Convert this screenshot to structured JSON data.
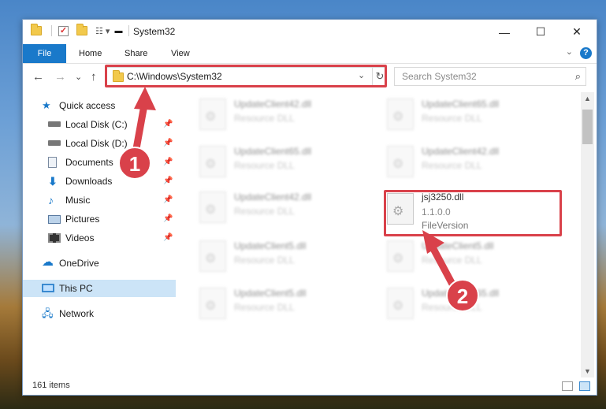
{
  "window": {
    "title": "System32",
    "controls": {
      "minimize": "—",
      "maximize": "☐",
      "close": "✕"
    }
  },
  "ribbon": {
    "file": "File",
    "tabs": [
      "Home",
      "Share",
      "View"
    ],
    "collapse": "⌄",
    "help": "?"
  },
  "nav": {
    "back": "←",
    "forward": "→",
    "recent": "⌄",
    "up": "↑",
    "address": "C:\\Windows\\System32",
    "address_dropdown": "⌄",
    "refresh": "↻",
    "search_placeholder": "Search System32",
    "search_icon": "⌕"
  },
  "sidebar": {
    "items": [
      {
        "label": "Quick access",
        "icon": "star-icon",
        "pinned": false
      },
      {
        "label": "Local Disk (C:)",
        "icon": "drive-icon",
        "pinned": true
      },
      {
        "label": "Local Disk (D:)",
        "icon": "drive-icon",
        "pinned": true
      },
      {
        "label": "Documents",
        "icon": "documents-icon",
        "pinned": true
      },
      {
        "label": "Downloads",
        "icon": "download-icon",
        "pinned": true
      },
      {
        "label": "Music",
        "icon": "music-icon",
        "pinned": true
      },
      {
        "label": "Pictures",
        "icon": "pictures-icon",
        "pinned": true
      },
      {
        "label": "Videos",
        "icon": "videos-icon",
        "pinned": true
      },
      {
        "label": "OneDrive",
        "icon": "cloud-icon",
        "pinned": false
      },
      {
        "label": "This PC",
        "icon": "computer-icon",
        "pinned": false
      },
      {
        "label": "Network",
        "icon": "network-icon",
        "pinned": false
      }
    ],
    "pin_glyph": "📌"
  },
  "files": [
    {
      "name": "UpdateClient42.dll",
      "type": "Resource DLL"
    },
    {
      "name": "UpdateClient65.dll",
      "type": "Resource DLL"
    },
    {
      "name": "UpdateClient65.dll",
      "type": "Resource DLL"
    },
    {
      "name": "UpdateClient42.dll",
      "type": "Resource DLL"
    },
    {
      "name": "UpdateClient42.dll",
      "type": "Resource DLL"
    },
    {
      "name": "jsj3250.dll",
      "version": "1.1.0.0",
      "description": "FileVersion"
    },
    {
      "name": "UpdateClient5.dll",
      "type": "Resource DLL"
    },
    {
      "name": "UpdateClient5.dll",
      "type": "Resource DLL"
    },
    {
      "name": "UpdateClient5.dll",
      "type": "Resource DLL"
    },
    {
      "name": "UpdateClient65.dll",
      "type": "Resource DLL"
    }
  ],
  "status": {
    "items": "161 items"
  },
  "annotations": {
    "badge1": "1",
    "badge2": "2",
    "color": "#d9414a"
  }
}
